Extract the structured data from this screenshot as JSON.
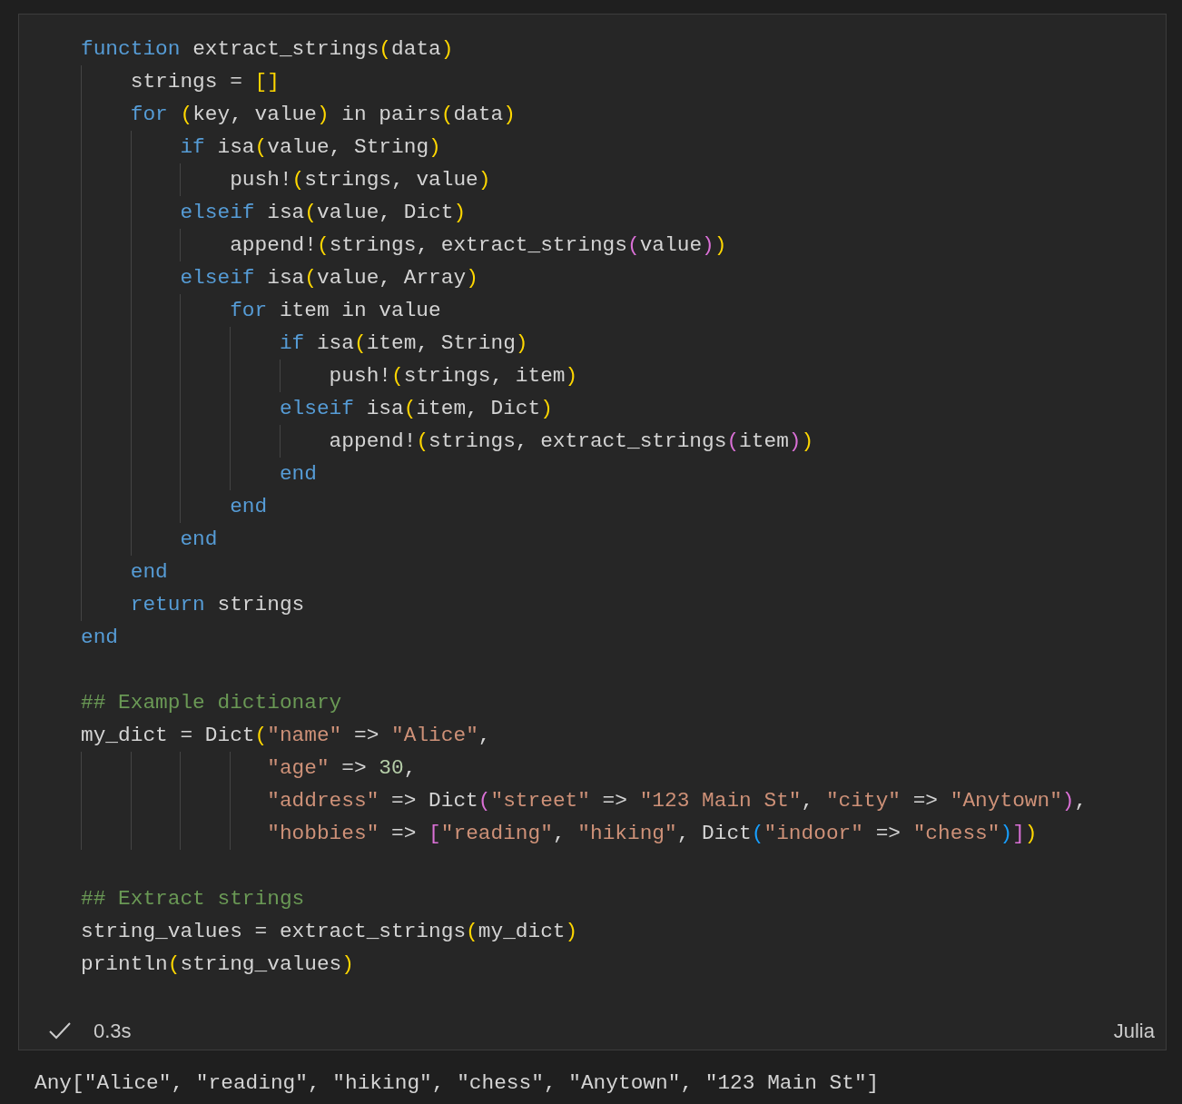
{
  "cell": {
    "language": "Julia",
    "status": {
      "succeeded": true,
      "duration": "0.3s"
    },
    "lines": [
      {
        "kind": "code",
        "tokens": [
          {
            "kind": "kw",
            "text": "function"
          },
          {
            "kind": "plain",
            "text": " extract_strings"
          },
          {
            "kind": "p1",
            "text": "("
          },
          {
            "kind": "plain",
            "text": "data"
          },
          {
            "kind": "p1",
            "text": ")"
          }
        ]
      },
      {
        "kind": "code",
        "tokens": [
          {
            "kind": "plain",
            "text": "    strings = "
          },
          {
            "kind": "p1",
            "text": "[]"
          }
        ]
      },
      {
        "kind": "code",
        "tokens": [
          {
            "kind": "kw",
            "text": "    for "
          },
          {
            "kind": "p1",
            "text": "("
          },
          {
            "kind": "plain",
            "text": "key, value"
          },
          {
            "kind": "p1",
            "text": ")"
          },
          {
            "kind": "plain",
            "text": " in pairs"
          },
          {
            "kind": "p1",
            "text": "("
          },
          {
            "kind": "plain",
            "text": "data"
          },
          {
            "kind": "p1",
            "text": ")"
          }
        ]
      },
      {
        "kind": "code",
        "tokens": [
          {
            "kind": "kw",
            "text": "        if "
          },
          {
            "kind": "plain",
            "text": "isa"
          },
          {
            "kind": "p1",
            "text": "("
          },
          {
            "kind": "plain",
            "text": "value, String"
          },
          {
            "kind": "p1",
            "text": ")"
          }
        ]
      },
      {
        "kind": "code",
        "tokens": [
          {
            "kind": "plain",
            "text": "            push!"
          },
          {
            "kind": "p1",
            "text": "("
          },
          {
            "kind": "plain",
            "text": "strings, value"
          },
          {
            "kind": "p1",
            "text": ")"
          }
        ]
      },
      {
        "kind": "code",
        "tokens": [
          {
            "kind": "kw",
            "text": "        elseif "
          },
          {
            "kind": "plain",
            "text": "isa"
          },
          {
            "kind": "p1",
            "text": "("
          },
          {
            "kind": "plain",
            "text": "value, Dict"
          },
          {
            "kind": "p1",
            "text": ")"
          }
        ]
      },
      {
        "kind": "code",
        "tokens": [
          {
            "kind": "plain",
            "text": "            append!"
          },
          {
            "kind": "p1",
            "text": "("
          },
          {
            "kind": "plain",
            "text": "strings, extract_strings"
          },
          {
            "kind": "p2",
            "text": "("
          },
          {
            "kind": "plain",
            "text": "value"
          },
          {
            "kind": "p2",
            "text": ")"
          },
          {
            "kind": "p1",
            "text": ")"
          }
        ]
      },
      {
        "kind": "code",
        "tokens": [
          {
            "kind": "kw",
            "text": "        elseif "
          },
          {
            "kind": "plain",
            "text": "isa"
          },
          {
            "kind": "p1",
            "text": "("
          },
          {
            "kind": "plain",
            "text": "value, Array"
          },
          {
            "kind": "p1",
            "text": ")"
          }
        ]
      },
      {
        "kind": "code",
        "tokens": [
          {
            "kind": "kw",
            "text": "            for "
          },
          {
            "kind": "plain",
            "text": "item in value"
          }
        ]
      },
      {
        "kind": "code",
        "tokens": [
          {
            "kind": "kw",
            "text": "                if "
          },
          {
            "kind": "plain",
            "text": "isa"
          },
          {
            "kind": "p1",
            "text": "("
          },
          {
            "kind": "plain",
            "text": "item, String"
          },
          {
            "kind": "p1",
            "text": ")"
          }
        ]
      },
      {
        "kind": "code",
        "tokens": [
          {
            "kind": "plain",
            "text": "                    push!"
          },
          {
            "kind": "p1",
            "text": "("
          },
          {
            "kind": "plain",
            "text": "strings, item"
          },
          {
            "kind": "p1",
            "text": ")"
          }
        ]
      },
      {
        "kind": "code",
        "tokens": [
          {
            "kind": "kw",
            "text": "                elseif "
          },
          {
            "kind": "plain",
            "text": "isa"
          },
          {
            "kind": "p1",
            "text": "("
          },
          {
            "kind": "plain",
            "text": "item, Dict"
          },
          {
            "kind": "p1",
            "text": ")"
          }
        ]
      },
      {
        "kind": "code",
        "tokens": [
          {
            "kind": "plain",
            "text": "                    append!"
          },
          {
            "kind": "p1",
            "text": "("
          },
          {
            "kind": "plain",
            "text": "strings, extract_strings"
          },
          {
            "kind": "p2",
            "text": "("
          },
          {
            "kind": "plain",
            "text": "item"
          },
          {
            "kind": "p2",
            "text": ")"
          },
          {
            "kind": "p1",
            "text": ")"
          }
        ]
      },
      {
        "kind": "code",
        "tokens": [
          {
            "kind": "kw",
            "text": "                end"
          }
        ]
      },
      {
        "kind": "code",
        "tokens": [
          {
            "kind": "kw",
            "text": "            end"
          }
        ]
      },
      {
        "kind": "code",
        "tokens": [
          {
            "kind": "kw",
            "text": "        end"
          }
        ]
      },
      {
        "kind": "code",
        "tokens": [
          {
            "kind": "kw",
            "text": "    end"
          }
        ]
      },
      {
        "kind": "code",
        "tokens": [
          {
            "kind": "kw",
            "text": "    return "
          },
          {
            "kind": "plain",
            "text": "strings"
          }
        ]
      },
      {
        "kind": "code",
        "tokens": [
          {
            "kind": "kw",
            "text": "end"
          }
        ]
      },
      {
        "kind": "blank"
      },
      {
        "kind": "code",
        "tokens": [
          {
            "kind": "comment",
            "text": "## Example dictionary"
          }
        ]
      },
      {
        "kind": "code",
        "tokens": [
          {
            "kind": "plain",
            "text": "my_dict = Dict"
          },
          {
            "kind": "p1",
            "text": "("
          },
          {
            "kind": "str",
            "text": "\"name\""
          },
          {
            "kind": "plain",
            "text": " => "
          },
          {
            "kind": "str",
            "text": "\"Alice\""
          },
          {
            "kind": "plain",
            "text": ","
          }
        ]
      },
      {
        "kind": "code",
        "tokens": [
          {
            "kind": "str",
            "text": "               \"age\""
          },
          {
            "kind": "plain",
            "text": " => "
          },
          {
            "kind": "num",
            "text": "30"
          },
          {
            "kind": "plain",
            "text": ","
          }
        ]
      },
      {
        "kind": "code",
        "tokens": [
          {
            "kind": "str",
            "text": "               \"address\""
          },
          {
            "kind": "plain",
            "text": " => Dict"
          },
          {
            "kind": "p2",
            "text": "("
          },
          {
            "kind": "str",
            "text": "\"street\""
          },
          {
            "kind": "plain",
            "text": " => "
          },
          {
            "kind": "str",
            "text": "\"123 Main St\""
          },
          {
            "kind": "plain",
            "text": ", "
          },
          {
            "kind": "str",
            "text": "\"city\""
          },
          {
            "kind": "plain",
            "text": " => "
          },
          {
            "kind": "str",
            "text": "\"Anytown\""
          },
          {
            "kind": "p2",
            "text": ")"
          },
          {
            "kind": "plain",
            "text": ","
          }
        ]
      },
      {
        "kind": "code",
        "tokens": [
          {
            "kind": "str",
            "text": "               \"hobbies\""
          },
          {
            "kind": "plain",
            "text": " => "
          },
          {
            "kind": "p2",
            "text": "["
          },
          {
            "kind": "str",
            "text": "\"reading\""
          },
          {
            "kind": "plain",
            "text": ", "
          },
          {
            "kind": "str",
            "text": "\"hiking\""
          },
          {
            "kind": "plain",
            "text": ", Dict"
          },
          {
            "kind": "p3",
            "text": "("
          },
          {
            "kind": "str",
            "text": "\"indoor\""
          },
          {
            "kind": "plain",
            "text": " => "
          },
          {
            "kind": "str",
            "text": "\"chess\""
          },
          {
            "kind": "p3",
            "text": ")"
          },
          {
            "kind": "p2",
            "text": "]"
          },
          {
            "kind": "p1",
            "text": ")"
          }
        ]
      },
      {
        "kind": "blank"
      },
      {
        "kind": "code",
        "tokens": [
          {
            "kind": "comment",
            "text": "## Extract strings"
          }
        ]
      },
      {
        "kind": "code",
        "tokens": [
          {
            "kind": "plain",
            "text": "string_values = extract_strings"
          },
          {
            "kind": "p1",
            "text": "("
          },
          {
            "kind": "plain",
            "text": "my_dict"
          },
          {
            "kind": "p1",
            "text": ")"
          }
        ]
      },
      {
        "kind": "code",
        "tokens": [
          {
            "kind": "plain",
            "text": "println"
          },
          {
            "kind": "p1",
            "text": "("
          },
          {
            "kind": "plain",
            "text": "string_values"
          },
          {
            "kind": "p1",
            "text": ")"
          }
        ]
      }
    ]
  },
  "output": "Any[\"Alice\", \"reading\", \"hiking\", \"chess\", \"Anytown\", \"123 Main St\"]"
}
